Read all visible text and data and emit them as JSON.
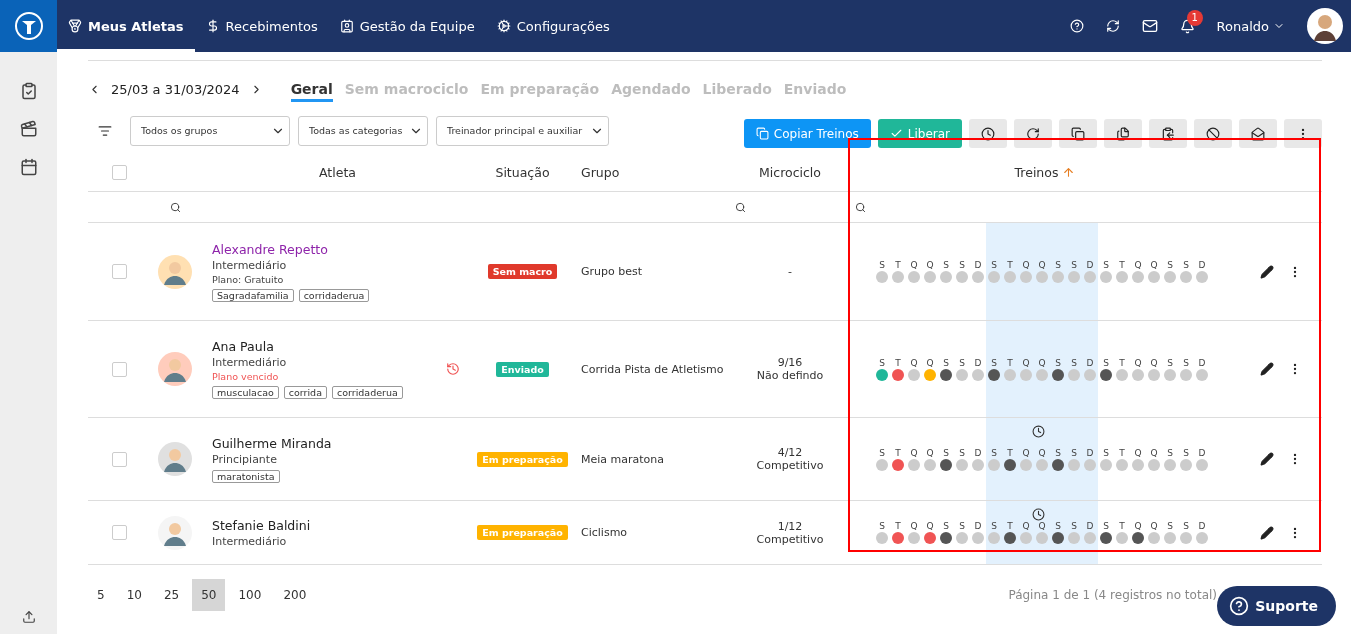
{
  "nav": {
    "items": [
      {
        "label": "Meus Atletas",
        "selected": true
      },
      {
        "label": "Recebimentos",
        "selected": false
      },
      {
        "label": "Gestão da Equipe",
        "selected": false
      },
      {
        "label": "Configurações",
        "selected": false
      }
    ],
    "notifications": "1",
    "user": "Ronaldo"
  },
  "period": "25/03 a 31/03/2024",
  "tabs": [
    {
      "label": "Geral",
      "selected": true
    },
    {
      "label": "Sem macrociclo",
      "selected": false
    },
    {
      "label": "Em preparação",
      "selected": false
    },
    {
      "label": "Agendado",
      "selected": false
    },
    {
      "label": "Liberado",
      "selected": false
    },
    {
      "label": "Enviado",
      "selected": false
    }
  ],
  "filters": [
    {
      "value": "Todos os grupos"
    },
    {
      "value": "Todas as categorias"
    },
    {
      "value": "Treinador principal e auxiliar"
    }
  ],
  "actions": {
    "copy": "Copiar Treinos",
    "release": "Liberar"
  },
  "table": {
    "all_checked": false,
    "columns": [
      "Atleta",
      "Situação",
      "Grupo",
      "Microciclo",
      "Treinos"
    ],
    "rows": [
      {
        "checked": false,
        "name": "Alexandre Repetto",
        "highlighted": true,
        "level": "Intermediário",
        "plan": "Plano: Gratuito",
        "plan_expired": false,
        "tags": [
          "Sagradafamilia",
          "corridaderua"
        ],
        "alert": false,
        "status": {
          "label": "Sem macro",
          "kind": "sem_macro"
        },
        "group": "Grupo best",
        "micro": [
          "-"
        ],
        "scheduled": false,
        "days": [
          {
            "label": "S",
            "color": "#cccccc"
          },
          {
            "label": "T",
            "color": "#cccccc"
          },
          {
            "label": "Q",
            "color": "#cccccc"
          },
          {
            "label": "Q",
            "color": "#cccccc"
          },
          {
            "label": "S",
            "color": "#cccccc"
          },
          {
            "label": "S",
            "color": "#cccccc"
          },
          {
            "label": "D",
            "color": "#cccccc"
          },
          {
            "label": "S",
            "color": "#cccccc"
          },
          {
            "label": "T",
            "color": "#cccccc"
          },
          {
            "label": "Q",
            "color": "#cccccc"
          },
          {
            "label": "Q",
            "color": "#cccccc"
          },
          {
            "label": "S",
            "color": "#cccccc"
          },
          {
            "label": "S",
            "color": "#cccccc"
          },
          {
            "label": "D",
            "color": "#cccccc"
          },
          {
            "label": "S",
            "color": "#cccccc"
          },
          {
            "label": "T",
            "color": "#cccccc"
          },
          {
            "label": "Q",
            "color": "#cccccc"
          },
          {
            "label": "Q",
            "color": "#cccccc"
          },
          {
            "label": "S",
            "color": "#cccccc"
          },
          {
            "label": "S",
            "color": "#cccccc"
          },
          {
            "label": "D",
            "color": "#cccccc"
          }
        ]
      },
      {
        "checked": false,
        "name": "Ana Paula",
        "highlighted": false,
        "level": "Intermediário",
        "plan": "Plano vencido",
        "plan_expired": true,
        "tags": [
          "musculacao",
          "corrida",
          "corridaderua"
        ],
        "alert": true,
        "status": {
          "label": "Enviado",
          "kind": "enviado"
        },
        "group": "Corrida Pista de Atletismo",
        "micro": [
          "9/16",
          "Não defindo"
        ],
        "scheduled": false,
        "days": [
          {
            "label": "S",
            "color": "#20b799"
          },
          {
            "label": "T",
            "color": "#f05454"
          },
          {
            "label": "Q",
            "color": "#cccccc"
          },
          {
            "label": "Q",
            "color": "#ffb300"
          },
          {
            "label": "S",
            "color": "#555555"
          },
          {
            "label": "S",
            "color": "#cccccc"
          },
          {
            "label": "D",
            "color": "#cccccc"
          },
          {
            "label": "S",
            "color": "#555555"
          },
          {
            "label": "T",
            "color": "#cccccc"
          },
          {
            "label": "Q",
            "color": "#cccccc"
          },
          {
            "label": "Q",
            "color": "#cccccc"
          },
          {
            "label": "S",
            "color": "#555555"
          },
          {
            "label": "S",
            "color": "#cccccc"
          },
          {
            "label": "D",
            "color": "#cccccc"
          },
          {
            "label": "S",
            "color": "#555555"
          },
          {
            "label": "T",
            "color": "#cccccc"
          },
          {
            "label": "Q",
            "color": "#cccccc"
          },
          {
            "label": "Q",
            "color": "#cccccc"
          },
          {
            "label": "S",
            "color": "#cccccc"
          },
          {
            "label": "S",
            "color": "#cccccc"
          },
          {
            "label": "D",
            "color": "#cccccc"
          }
        ]
      },
      {
        "checked": false,
        "name": "Guilherme Miranda",
        "highlighted": false,
        "level": "Principiante",
        "tags": [
          "maratonista"
        ],
        "alert": false,
        "status": {
          "label": "Em preparação",
          "kind": "em_preparacao"
        },
        "group": "Meia maratona",
        "micro": [
          "4/12",
          "Competitivo"
        ],
        "scheduled": true,
        "days": [
          {
            "label": "S",
            "color": "#cccccc"
          },
          {
            "label": "T",
            "color": "#f05454"
          },
          {
            "label": "Q",
            "color": "#cccccc"
          },
          {
            "label": "Q",
            "color": "#cccccc"
          },
          {
            "label": "S",
            "color": "#555555"
          },
          {
            "label": "S",
            "color": "#cccccc"
          },
          {
            "label": "D",
            "color": "#cccccc"
          },
          {
            "label": "S",
            "color": "#cccccc"
          },
          {
            "label": "T",
            "color": "#555555"
          },
          {
            "label": "Q",
            "color": "#cccccc"
          },
          {
            "label": "Q",
            "color": "#cccccc"
          },
          {
            "label": "S",
            "color": "#555555"
          },
          {
            "label": "S",
            "color": "#cccccc"
          },
          {
            "label": "D",
            "color": "#cccccc"
          },
          {
            "label": "S",
            "color": "#cccccc"
          },
          {
            "label": "T",
            "color": "#cccccc"
          },
          {
            "label": "Q",
            "color": "#cccccc"
          },
          {
            "label": "Q",
            "color": "#cccccc"
          },
          {
            "label": "S",
            "color": "#cccccc"
          },
          {
            "label": "S",
            "color": "#cccccc"
          },
          {
            "label": "D",
            "color": "#cccccc"
          }
        ]
      },
      {
        "checked": false,
        "name": "Stefanie Baldini",
        "highlighted": false,
        "level": "Intermediário",
        "tags": [],
        "alert": false,
        "status": {
          "label": "Em preparação",
          "kind": "em_preparacao"
        },
        "group": "Ciclismo",
        "micro": [
          "1/12",
          "Competitivo"
        ],
        "scheduled": true,
        "days": [
          {
            "label": "S",
            "color": "#cccccc"
          },
          {
            "label": "T",
            "color": "#f05454"
          },
          {
            "label": "Q",
            "color": "#cccccc"
          },
          {
            "label": "Q",
            "color": "#f05454"
          },
          {
            "label": "S",
            "color": "#555555"
          },
          {
            "label": "S",
            "color": "#cccccc"
          },
          {
            "label": "D",
            "color": "#cccccc"
          },
          {
            "label": "S",
            "color": "#cccccc"
          },
          {
            "label": "T",
            "color": "#555555"
          },
          {
            "label": "Q",
            "color": "#cccccc"
          },
          {
            "label": "Q",
            "color": "#cccccc"
          },
          {
            "label": "S",
            "color": "#555555"
          },
          {
            "label": "S",
            "color": "#cccccc"
          },
          {
            "label": "D",
            "color": "#cccccc"
          },
          {
            "label": "S",
            "color": "#555555"
          },
          {
            "label": "T",
            "color": "#cccccc"
          },
          {
            "label": "Q",
            "color": "#555555"
          },
          {
            "label": "Q",
            "color": "#cccccc"
          },
          {
            "label": "S",
            "color": "#cccccc"
          },
          {
            "label": "S",
            "color": "#cccccc"
          },
          {
            "label": "D",
            "color": "#cccccc"
          }
        ]
      }
    ]
  },
  "pagination": {
    "sizes": [
      {
        "label": "5",
        "selected": false
      },
      {
        "label": "10",
        "selected": false
      },
      {
        "label": "25",
        "selected": false
      },
      {
        "label": "50",
        "selected": true
      },
      {
        "label": "100",
        "selected": false
      },
      {
        "label": "200",
        "selected": false
      }
    ],
    "summary": "Página 1 de 1 (4 registros no total)"
  },
  "support": "Suporte"
}
